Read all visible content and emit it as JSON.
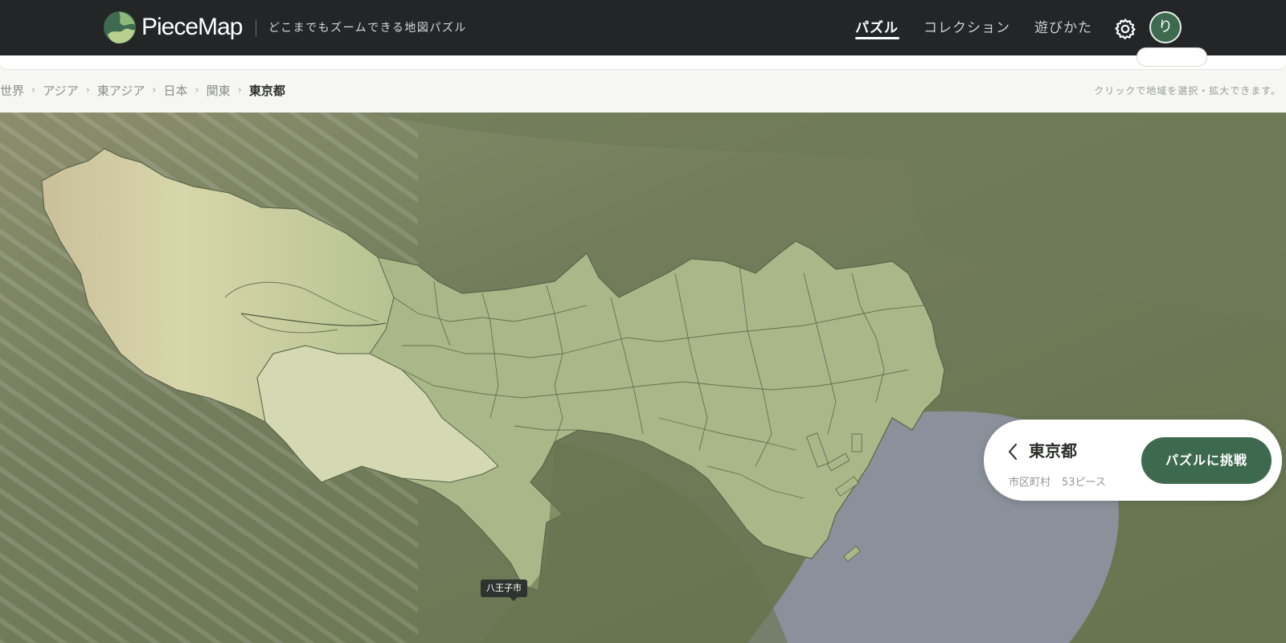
{
  "header": {
    "brand": "PieceMap",
    "tagline": "どこまでもズームできる地図パズル",
    "nav": [
      {
        "label": "パズル",
        "active": true
      },
      {
        "label": "コレクション",
        "active": false
      },
      {
        "label": "遊びかた",
        "active": false
      }
    ],
    "settings_icon": "gear-icon",
    "avatar_initial": "り"
  },
  "breadcrumb": {
    "items": [
      "世界",
      "アジア",
      "東アジア",
      "日本",
      "関東",
      "東京都"
    ],
    "separator": "›"
  },
  "hint": "クリックで地域を選択・拡大できます。",
  "map": {
    "region_label": "八王子市",
    "colors": {
      "terrain": "#737d5c",
      "region_fill": "#a8b888",
      "region_border": "#5a6448",
      "bay_water": "#8b909a"
    }
  },
  "info_card": {
    "title": "東京都",
    "unit_label": "市区町村",
    "pieces_label": "53ピース",
    "cta_label": "パズルに挑戦",
    "back_icon": "chevron-left-icon"
  },
  "colors": {
    "topbar": "#232527",
    "accent": "#3d6a4f"
  }
}
